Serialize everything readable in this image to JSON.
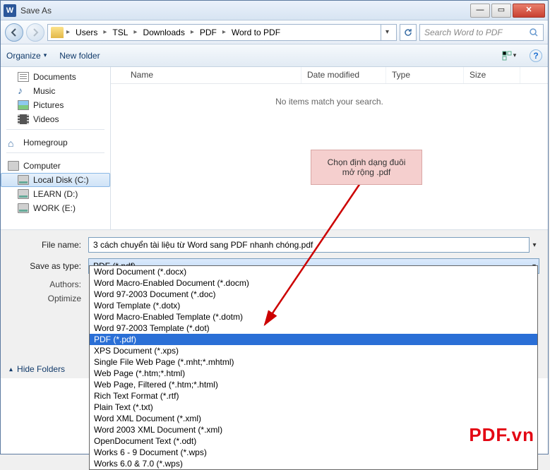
{
  "window": {
    "title": "Save As",
    "close_glyph": "✕",
    "min_glyph": "—",
    "max_glyph": "▭"
  },
  "nav": {
    "breadcrumb": [
      "Users",
      "TSL",
      "Downloads",
      "PDF",
      "Word to PDF"
    ],
    "search_placeholder": "Search Word to PDF"
  },
  "toolbar": {
    "organize": "Organize",
    "newfolder": "New folder"
  },
  "tree": {
    "documents": "Documents",
    "music": "Music",
    "pictures": "Pictures",
    "videos": "Videos",
    "homegroup": "Homegroup",
    "computer": "Computer",
    "localdisk": "Local Disk (C:)",
    "learn": "LEARN (D:)",
    "work": "WORK (E:)"
  },
  "columns": {
    "name": "Name",
    "date": "Date modified",
    "type": "Type",
    "size": "Size"
  },
  "empty": "No items match your search.",
  "form": {
    "filename_label": "File name:",
    "filename_value": "3 cách chuyển tài liệu từ Word sang PDF nhanh chóng.pdf",
    "saveas_label": "Save as type:",
    "saveas_value": "PDF (*.pdf)",
    "authors_label": "Authors:",
    "optimize_label": "Optimize",
    "hide_folders": "Hide Folders"
  },
  "filetypes": [
    "Word Document (*.docx)",
    "Word Macro-Enabled Document (*.docm)",
    "Word 97-2003 Document (*.doc)",
    "Word Template (*.dotx)",
    "Word Macro-Enabled Template (*.dotm)",
    "Word 97-2003 Template (*.dot)",
    "PDF (*.pdf)",
    "XPS Document (*.xps)",
    "Single File Web Page (*.mht;*.mhtml)",
    "Web Page (*.htm;*.html)",
    "Web Page, Filtered (*.htm;*.html)",
    "Rich Text Format (*.rtf)",
    "Plain Text (*.txt)",
    "Word XML Document (*.xml)",
    "Word 2003 XML Document (*.xml)",
    "OpenDocument Text (*.odt)",
    "Works 6 - 9 Document (*.wps)",
    "Works 6.0 & 7.0 (*.wps)"
  ],
  "filetypes_selected_index": 6,
  "annotation": {
    "line1": "Chọn định dạng đuôi",
    "line2": "mở rộng .pdf"
  },
  "watermark": "PDF.vn"
}
